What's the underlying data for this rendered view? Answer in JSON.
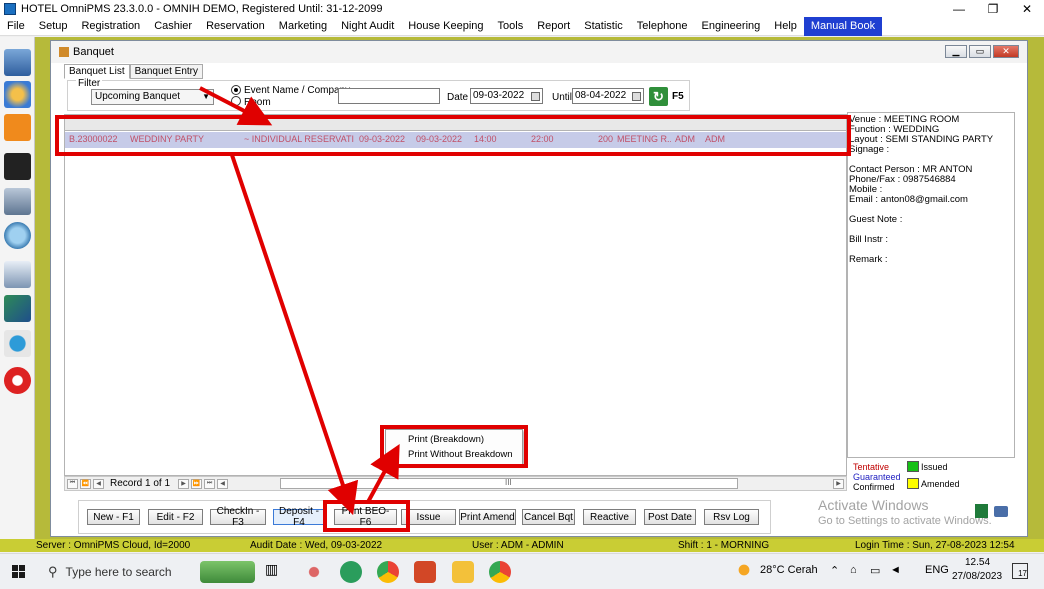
{
  "window": {
    "title": "HOTEL OmniPMS 23.3.0.0 - OMNIH DEMO, Registered Until: 31-12-2099",
    "controls": [
      "—",
      "❐",
      "✕"
    ]
  },
  "menu": [
    "File",
    "Setup",
    "Registration",
    "Cashier",
    "Reservation",
    "Marketing",
    "Night Audit",
    "House Keeping",
    "Tools",
    "Report",
    "Statistic",
    "Telephone",
    "Engineering",
    "Help",
    "Manual Book"
  ],
  "inner_window": {
    "title": "Banquet",
    "tabs": [
      "Banquet List",
      "Banquet Entry"
    ]
  },
  "filter": {
    "legend": "Filter",
    "selected": "Upcoming Banquet",
    "radio_event": "Event Name / Company",
    "radio_room": "Room",
    "search_value": "",
    "date_label": "Date",
    "date_value": "09-03-2022",
    "until_label": "Until",
    "until_value": "08-04-2022",
    "refresh_key": "F5"
  },
  "grid": {
    "row": {
      "code": "B.23000022",
      "event": "WEDDINY PARTY",
      "company": "~ INDIVIDUAL RESERVATI...",
      "start": "09-03-2022",
      "end": "09-03-2022",
      "start_time": "14:00",
      "end_time": "22:00",
      "pax": "200",
      "venue": "MEETING R...",
      "user": "ADM",
      "mod": "ADM"
    },
    "record_text": "Record 1 of 1",
    "scroll_mark": "III"
  },
  "info": {
    "venue": "Venue : MEETING ROOM",
    "function": "Function : WEDDING",
    "layout": "Layout : SEMI STANDING PARTY",
    "signage": "Signage :",
    "contact": "Contact Person : MR ANTON",
    "phone": "Phone/Fax : 0987546884",
    "mobile": "Mobile :",
    "email": "Email : anton08@gmail.com",
    "guest_note": "Guest Note :",
    "bill_instr": "Bill Instr :",
    "remark": "Remark :"
  },
  "legend": {
    "tentative": "Tentative",
    "guaranteed": "Guaranteed",
    "confirmed": "Confirmed",
    "issued": "Issued",
    "amended": "Amended",
    "colors": {
      "tentative": "#c00000",
      "guaranteed": "#2020c0",
      "issued": "#16c016",
      "amended": "#ffff00"
    }
  },
  "buttons": [
    "New - F1",
    "Edit - F2",
    "CheckIn - F3",
    "Deposit - F4",
    "Print BEO- F6",
    "Issue",
    "Print Amend",
    "Cancel Bqt",
    "Reactive",
    "Post Date",
    "Rsv Log"
  ],
  "context_menu": [
    "Print (Breakdown)",
    "Print Without Breakdown"
  ],
  "watermark": {
    "line1": "Activate Windows",
    "line2": "Go to Settings to activate Windows."
  },
  "status": {
    "server": "Server : OmniPMS Cloud, Id=2000",
    "audit": "Audit Date : Wed, 09-03-2022",
    "user": "User : ADM - ADMIN",
    "shift": "Shift : 1 - MORNING",
    "login": "Login Time : Sun, 27-08-2023 12:54"
  },
  "taskbar": {
    "search_placeholder": "Type here to search",
    "weather": "28°C  Cerah",
    "lang": "ENG",
    "time": "12.54",
    "date": "27/08/2023",
    "notif": "17"
  },
  "annotation_color": "#e00000"
}
